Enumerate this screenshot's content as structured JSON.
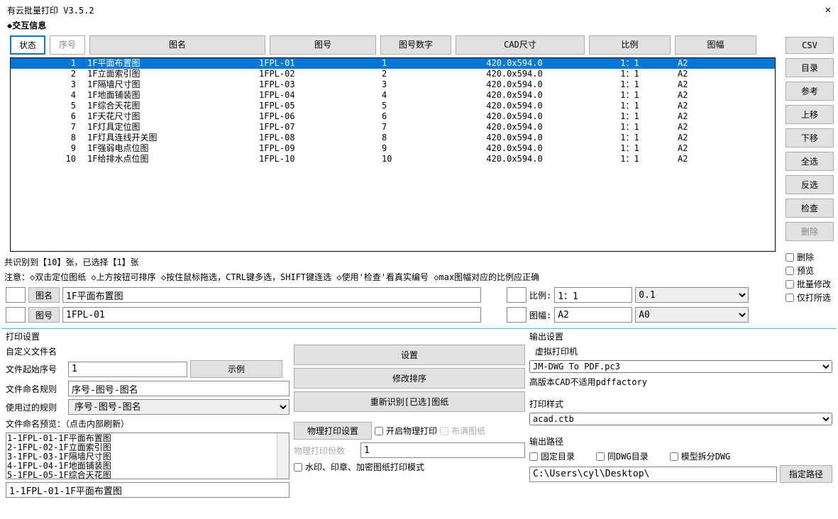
{
  "title": "有云批量打印 V3.5.2",
  "section": "交互信息",
  "headers": {
    "status": "状态",
    "num": "序号",
    "name": "图名",
    "code": "图号",
    "codenr": "图号数字",
    "cad": "CAD尺寸",
    "scale": "比例",
    "frame": "图幅"
  },
  "rows": [
    {
      "num": "1",
      "name": "1F平面布置图",
      "code": "1FPL-01",
      "codenr": "1",
      "cad": "420.0x594.0",
      "scale": "1：1",
      "frame": "A2"
    },
    {
      "num": "2",
      "name": "1F立面索引图",
      "code": "1FPL-02",
      "codenr": "2",
      "cad": "420.0x594.0",
      "scale": "1：1",
      "frame": "A2"
    },
    {
      "num": "3",
      "name": "1F隔墙尺寸图",
      "code": "1FPL-03",
      "codenr": "3",
      "cad": "420.0x594.0",
      "scale": "1：1",
      "frame": "A2"
    },
    {
      "num": "4",
      "name": "1F地面铺装图",
      "code": "1FPL-04",
      "codenr": "4",
      "cad": "420.0x594.0",
      "scale": "1：1",
      "frame": "A2"
    },
    {
      "num": "5",
      "name": "1F综合天花图",
      "code": "1FPL-05",
      "codenr": "5",
      "cad": "420.0x594.0",
      "scale": "1：1",
      "frame": "A2"
    },
    {
      "num": "6",
      "name": "1F天花尺寸图",
      "code": "1FPL-06",
      "codenr": "6",
      "cad": "420.0x594.0",
      "scale": "1：1",
      "frame": "A2"
    },
    {
      "num": "7",
      "name": "1F灯具定位图",
      "code": "1FPL-07",
      "codenr": "7",
      "cad": "420.0x594.0",
      "scale": "1：1",
      "frame": "A2"
    },
    {
      "num": "8",
      "name": "1F灯具连线开关图",
      "code": "1FPL-08",
      "codenr": "8",
      "cad": "420.0x594.0",
      "scale": "1：1",
      "frame": "A2"
    },
    {
      "num": "9",
      "name": "1F强弱电点位图",
      "code": "1FPL-09",
      "codenr": "9",
      "cad": "420.0x594.0",
      "scale": "1：1",
      "frame": "A2"
    },
    {
      "num": "10",
      "name": "1F给排水点位图",
      "code": "1FPL-10",
      "codenr": "10",
      "cad": "420.0x594.0",
      "scale": "1：1",
      "frame": "A2"
    }
  ],
  "sidebar": [
    "CSV",
    "目录",
    "参考",
    "上移",
    "下移",
    "全选",
    "反选",
    "检查",
    "删除"
  ],
  "checks": [
    "删除",
    "预览",
    "批量修改",
    "仅打所选"
  ],
  "statusText": "共识别到【10】张，已选择【1】张",
  "hintText": "注意：◇双击定位图纸 ◇上方按钮可排序 ◇按住鼠标拖选，CTRL键多选，SHIFT键连选 ◇使用'检查'看真实编号 ◇max图幅对应的比例应正确",
  "edit": {
    "nameLbl": "图名",
    "nameVal": "1F平面布置图",
    "scaleLbl": "比例:",
    "scaleVal": "1：1",
    "scaleSel": "0.1",
    "codeLbl": "图号",
    "codeVal": "1FPL-01",
    "frameLbl": "图幅:",
    "frameVal": "A2",
    "frameSel": "A0"
  },
  "print": {
    "section": "打印设置",
    "customName": "自定义文件名",
    "startNumLbl": "文件起始序号",
    "startNumVal": "1",
    "exampleBtn": "示例",
    "ruleLbl": "文件命名规则",
    "ruleVal": "序号-图号-图名",
    "usedRuleLbl": "使用过的规则",
    "usedRuleVal": "序号-图号-图名",
    "previewLbl": "文件命名预览：（点击内部刷新）",
    "previewItems": [
      "1-1FPL-01-1F平面布置图",
      "2-1FPL-02-1F立面索引图",
      "3-1FPL-03-1F隔墙尺寸图",
      "4-1FPL-04-1F地面铺装图",
      "5-1FPL-05-1F综合天花图"
    ],
    "selectedPreview": "1-1FPL-01-1F平面布置图"
  },
  "mid": {
    "settingsBtn": "设置",
    "reorderBtn": "修改排序",
    "reidBtn": "重新识别[已选]图纸",
    "physSetBtn": "物理打印设置",
    "openPhysChk": "开启物理打印",
    "fullPaperChk": "布满图纸",
    "physCopyLbl": "物理打印份数",
    "physCopyVal": "1",
    "watermarkChk": "水印、印章、加密图纸打印模式"
  },
  "out": {
    "section": "输出设置",
    "vprinter": "虚拟打印机",
    "printerSel": "JM-DWG To PDF.pc3",
    "warn": "高版本CAD不适用pdffactory",
    "styleLbl": "打印样式",
    "styleSel": "acad.ctb",
    "pathLbl": "输出路径",
    "fixedDirChk": "固定目录",
    "sameDwgChk": "同DWG目录",
    "splitModelChk": "模型拆分DWG",
    "pathVal": "C:\\Users\\cyl\\Desktop\\",
    "pathBtn": "指定路径"
  }
}
